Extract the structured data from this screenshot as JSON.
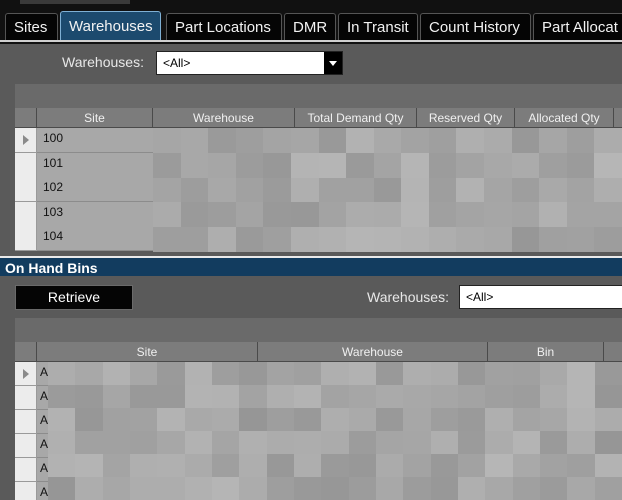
{
  "tabs": [
    {
      "label": "Sites",
      "active": false
    },
    {
      "label": "Warehouses",
      "active": true
    },
    {
      "label": "Part Locations",
      "active": false
    },
    {
      "label": "DMR",
      "active": false
    },
    {
      "label": "In Transit",
      "active": false
    },
    {
      "label": "Count History",
      "active": false
    },
    {
      "label": "Part Allocat",
      "active": false
    }
  ],
  "warehouses_panel": {
    "filter_label": "Warehouses:",
    "filter_value": "<All>",
    "columns": [
      "Site",
      "Warehouse",
      "Total Demand Qty",
      "Reserved Qty",
      "Allocated Qty"
    ],
    "rows": [
      "100",
      "101",
      "102",
      "103",
      "104"
    ]
  },
  "on_hand_bins": {
    "title": "On Hand Bins",
    "retrieve_label": "Retrieve",
    "filter_label": "Warehouses:",
    "filter_value": "<All>",
    "columns": [
      "Site",
      "Warehouse",
      "Bin"
    ],
    "rows": [
      "A",
      "A",
      "A",
      "A",
      "A",
      "A"
    ]
  },
  "colors": {
    "active_tab": "#1c4a6e",
    "panel_header": "#123c5f",
    "background": "#5a5a5a"
  }
}
